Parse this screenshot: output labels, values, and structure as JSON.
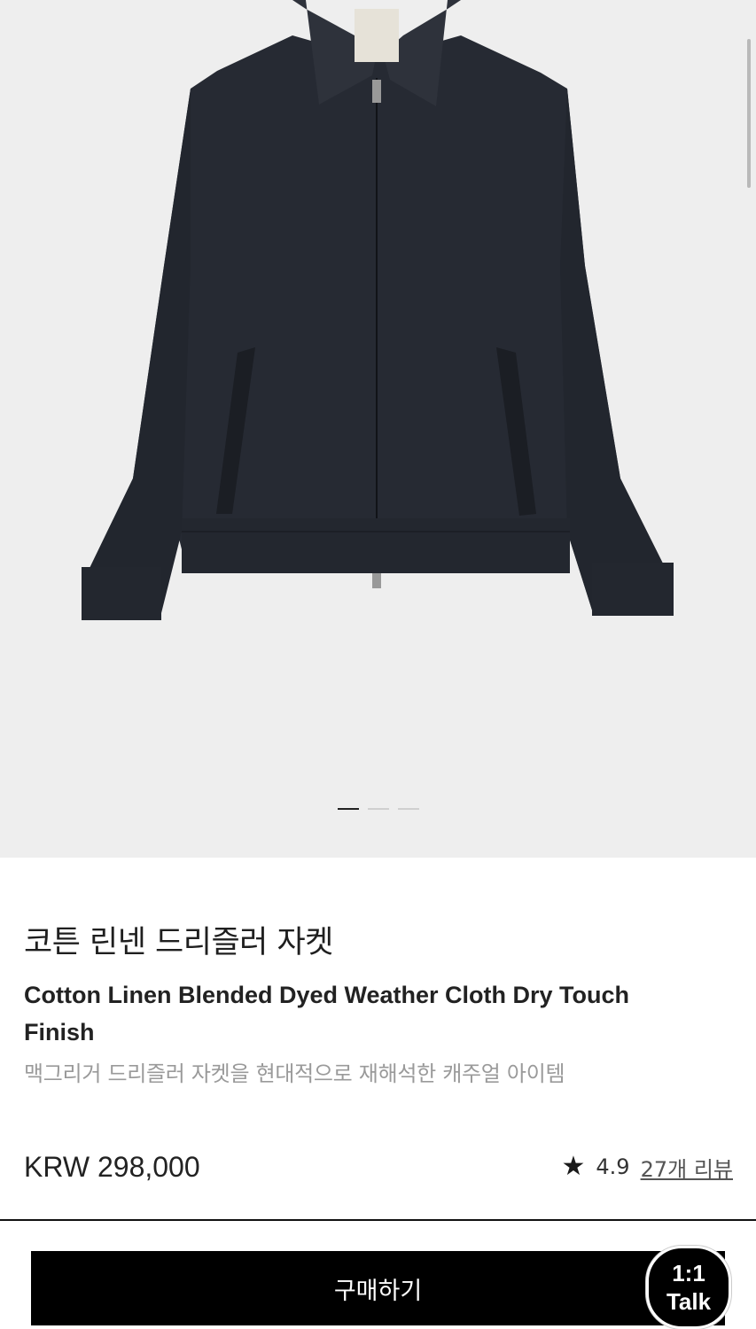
{
  "gallery": {
    "image_alt": "product-photo-jacket",
    "slides": 3,
    "active_slide": 1
  },
  "product": {
    "title_ko": "코튼 린넨 드리즐러 자켓",
    "title_en": "Cotton Linen Blended Dyed Weather Cloth Dry Touch Finish",
    "subtitle": "맥그리거 드리즐러 자켓을 현대적으로 재해석한 캐주얼 아이템",
    "price": "KRW 298,000",
    "rating": "4.9",
    "reviews": "27개 리뷰"
  },
  "footer": {
    "buy_label": "구매하기",
    "talk_line1": "1:1",
    "talk_line2": "Talk"
  },
  "colors": {
    "gallery_bg": "#eeeeee",
    "jacket": "#262a33",
    "button_bg": "#000000"
  }
}
